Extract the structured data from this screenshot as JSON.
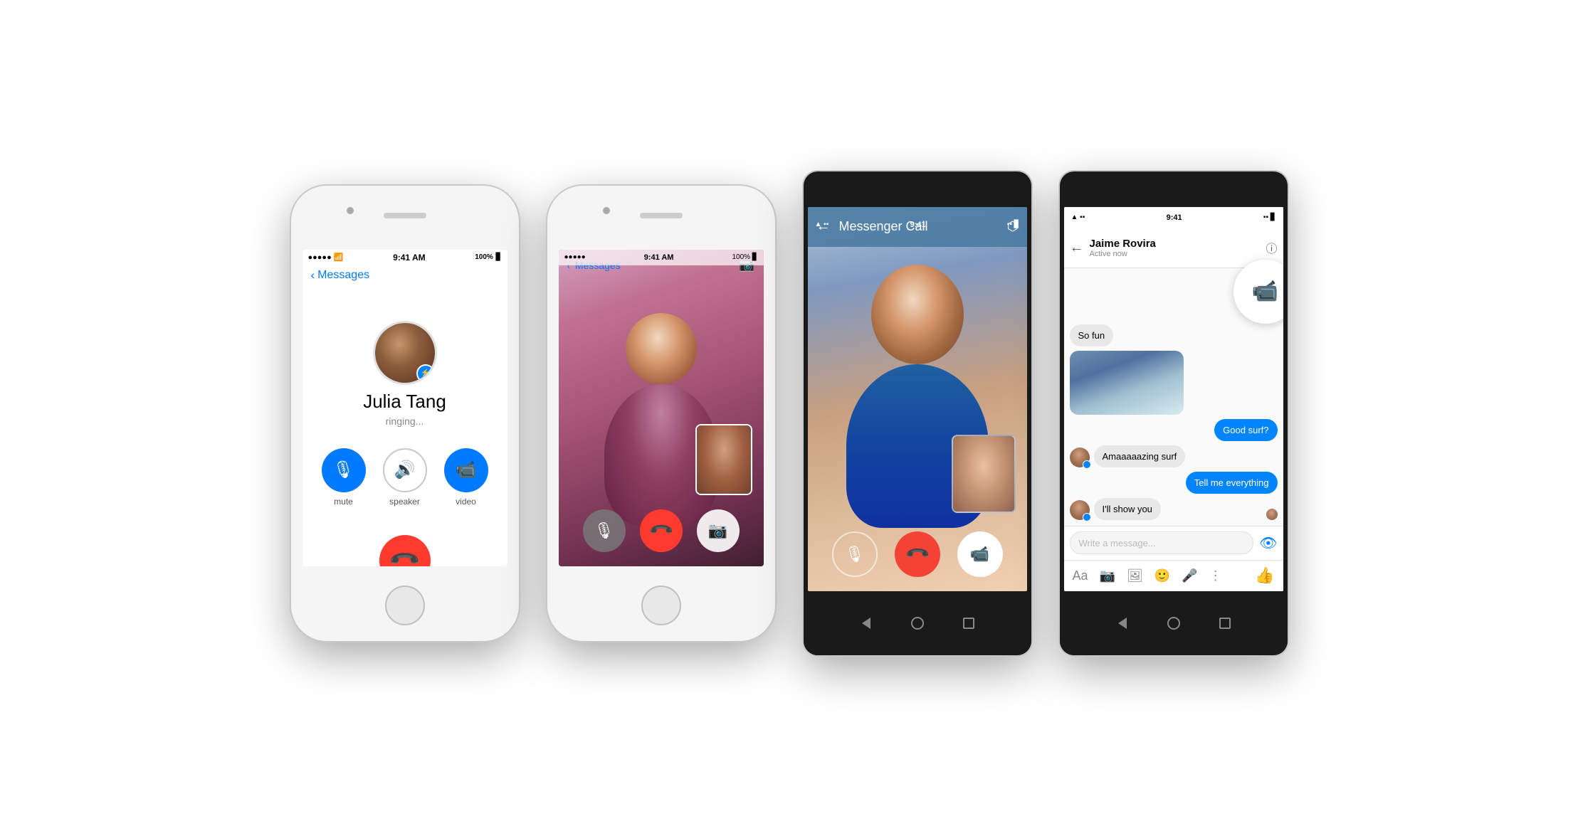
{
  "phone1": {
    "type": "iphone_white",
    "status_bar": {
      "signals": "●●●●●",
      "wifi": "WiFi",
      "time": "9:41 AM",
      "battery": "100%"
    },
    "nav": {
      "back_label": "Messages"
    },
    "contact": {
      "name": "Julia Tang",
      "status": "ringing..."
    },
    "buttons": {
      "mute_label": "mute",
      "speaker_label": "speaker",
      "video_label": "video"
    }
  },
  "phone2": {
    "type": "iphone_white",
    "status_bar": {
      "signals": "●●●●●",
      "wifi": "WiFi",
      "time": "9:41 AM",
      "battery": "100%"
    },
    "nav": {
      "back_label": "Messages"
    }
  },
  "phone3": {
    "type": "android_dark",
    "status_bar": {
      "time": "9:41",
      "icons": "▾ ▪ ▪"
    },
    "header": {
      "title": "Messenger Call"
    }
  },
  "phone4": {
    "type": "android_dark",
    "status_bar": {
      "time": "9:41",
      "icons": "▾ ▪ ▪"
    },
    "contact": {
      "name": "Jaime Rovira",
      "status": "Active now"
    },
    "messages": [
      {
        "id": 1,
        "type": "received",
        "text": "So fun",
        "has_avatar": false
      },
      {
        "id": 2,
        "type": "received",
        "subtype": "photo",
        "has_avatar": false
      },
      {
        "id": 3,
        "type": "sent",
        "text": "Good surf?"
      },
      {
        "id": 4,
        "type": "received",
        "text": "Amaaaaazing surf",
        "has_avatar": true
      },
      {
        "id": 5,
        "type": "sent",
        "text": "Tell me everything"
      },
      {
        "id": 6,
        "type": "received",
        "text": "I'll show you",
        "has_avatar": true
      }
    ],
    "input": {
      "placeholder": "Write a message..."
    },
    "toolbar": {
      "icons": [
        "Aa",
        "📷",
        "🖼",
        "🙂",
        "🎤",
        "⋮"
      ]
    }
  }
}
